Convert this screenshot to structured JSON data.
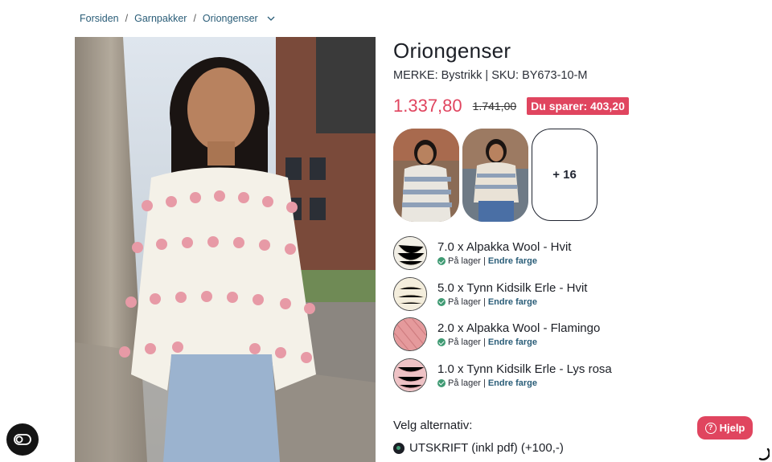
{
  "breadcrumb": {
    "items": [
      "Forsiden",
      "Garnpakker",
      "Oriongenser"
    ],
    "separator": "/",
    "dropdown_icon": "chevron-down-icon"
  },
  "product": {
    "title": "Oriongenser",
    "meta": "MERKE: Bystrikk | SKU: BY673-10-M",
    "price": "1.337,80",
    "old_price": "1.741,00",
    "save_label": "Du sparer: 403,20"
  },
  "gallery": {
    "more_label": "+ 16"
  },
  "yarns": [
    {
      "name": "7.0 x Alpakka Wool - Hvit",
      "stock": "På lager",
      "change": "Endre farge",
      "swatch_color": "#f2efe6"
    },
    {
      "name": "5.0 x Tynn Kidsilk Erle - Hvit",
      "stock": "På lager",
      "change": "Endre farge",
      "swatch_color": "#f4eedd"
    },
    {
      "name": "2.0 x Alpakka Wool - Flamingo",
      "stock": "På lager",
      "change": "Endre farge",
      "swatch_color": "#e59a9c"
    },
    {
      "name": "1.0 x Tynn Kidsilk Erle - Lys rosa",
      "stock": "På lager",
      "change": "Endre farge",
      "swatch_color": "#eec2c5"
    }
  ],
  "options": {
    "label": "Velg alternativ:",
    "items": [
      {
        "label": "UTSKRIFT (inkl pdf) (+100,-)",
        "selected": true
      }
    ]
  },
  "help": {
    "label": "Hjelp",
    "icon": "question-icon"
  },
  "accessibility": {
    "icon": "accessibility-toggle-icon"
  },
  "colors": {
    "accent": "#e0455f",
    "link": "#2a5d78",
    "stock_green": "#3f9a73"
  }
}
